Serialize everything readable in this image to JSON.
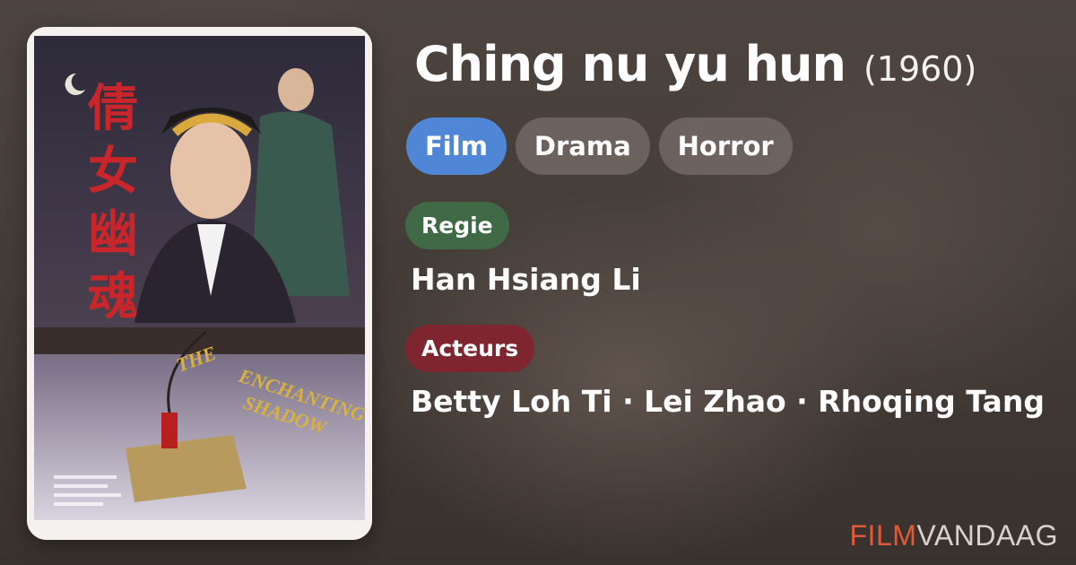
{
  "movie": {
    "title": "Ching nu yu hun",
    "year": "(1960)",
    "tags": [
      "Film",
      "Drama",
      "Horror"
    ]
  },
  "sections": {
    "director_label": "Regie",
    "director": "Han Hsiang Li",
    "cast_label": "Acteurs",
    "cast": "Betty Loh Ti · Lei Zhao · Rhoqing Tang"
  },
  "brand": {
    "part1": "FILM",
    "part2": "VANDAAG"
  },
  "colors": {
    "film_tag": "#4f86d6",
    "regie": "#3f6a45",
    "acteurs": "#7e2530",
    "brand_accent": "#e05a3a"
  }
}
